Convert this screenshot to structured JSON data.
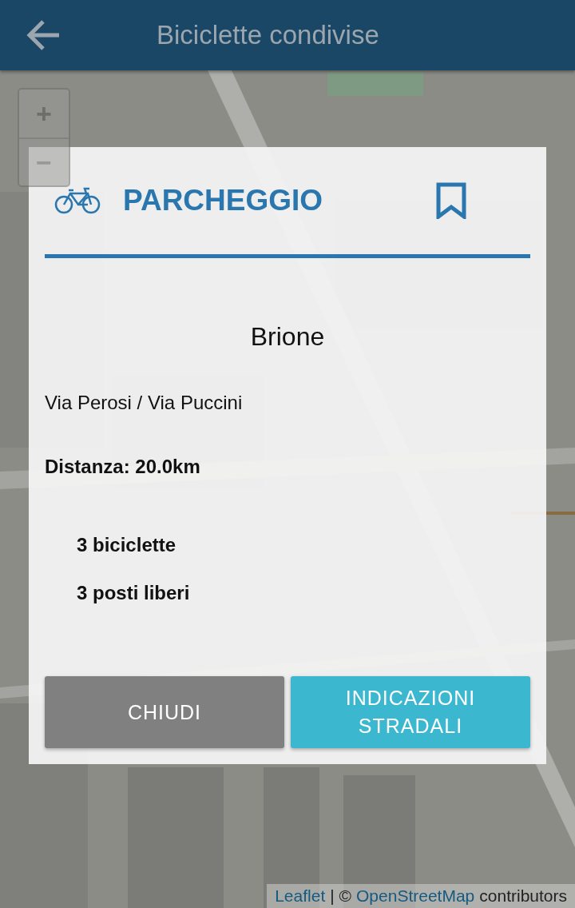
{
  "app_bar": {
    "title": "Biciclette condivise"
  },
  "zoom_controls": [
    "+",
    "−"
  ],
  "dialog": {
    "title": "PARCHEGGIO",
    "bookmarked": false,
    "name": "Brione",
    "address": "Via Perosi / Via Puccini",
    "distance": "Distanza: 20.0km",
    "availability": [
      "3 biciclette",
      "3 posti liberi"
    ],
    "buttons": [
      {
        "label": "CHIUDI",
        "kind": "secondary"
      },
      {
        "label": "INDICAZIONI STRADALI",
        "kind": "primary"
      }
    ]
  },
  "attribution": {
    "link_1": "Leaflet",
    "separator": "| ©",
    "link_2": "OpenStreetMap",
    "text": "contributors"
  }
}
